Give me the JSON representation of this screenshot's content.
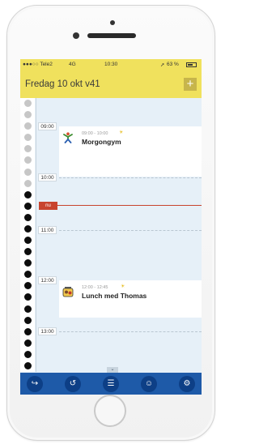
{
  "status_bar": {
    "carrier": "●●●○○ Tele2",
    "network": "4G",
    "time": "10:30",
    "battery_pct": "63 %",
    "location_icon": "location-arrow-icon"
  },
  "header": {
    "title": "Fredag 10 okt v41",
    "add_label": "+",
    "background": "#f0e15d"
  },
  "timeline": {
    "hour_labels": [
      "09:00",
      "10:00",
      "11:00",
      "12:00",
      "13:00"
    ],
    "now_label": "nu",
    "now_color": "#c8442e",
    "past_dot_color": "#c7c7c7",
    "future_dot_color": "#0d0d0d",
    "dots_past": 8,
    "dots_future": 16
  },
  "events": [
    {
      "time": "09:00 - 10:00",
      "title": "Morgongym",
      "icon": "exercise-person-icon"
    },
    {
      "time": "12:00 - 12:45",
      "title": "Lunch med Thomas",
      "icon": "lunch-icon"
    }
  ],
  "collapse_label": "⌄",
  "tab_bar": {
    "color": "#1e5aa8",
    "tabs": [
      {
        "name": "tab-forward",
        "glyph": "↪",
        "icon": "forward-icon"
      },
      {
        "name": "tab-history",
        "glyph": "↺",
        "icon": "history-icon"
      },
      {
        "name": "tab-list",
        "glyph": "☰",
        "icon": "list-icon"
      },
      {
        "name": "tab-contacts",
        "glyph": "☺",
        "icon": "contacts-icon"
      },
      {
        "name": "tab-settings",
        "glyph": "⚙",
        "icon": "settings-icon"
      }
    ]
  }
}
